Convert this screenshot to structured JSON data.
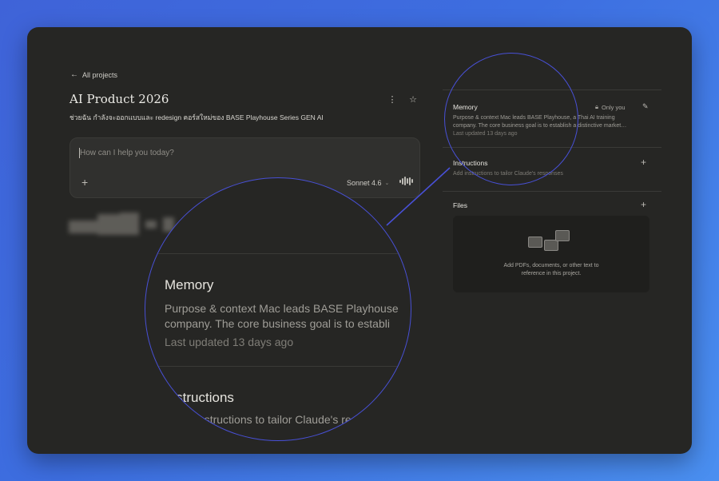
{
  "nav": {
    "back_label": "All projects"
  },
  "project": {
    "title": "AI Product 2026",
    "description": "ช่วยฉัน กำลังจะออกแบบและ redesign คอร์สใหม่ของ BASE Playhouse Series GEN AI"
  },
  "composer": {
    "placeholder": "How can I help you today?",
    "model": "Sonnet 4.6"
  },
  "memory": {
    "title": "Memory",
    "visibility": "Only you",
    "text_line1": "Purpose & context Mac leads BASE Playhouse, a Thai AI training",
    "text_line2": "company. The core business goal is to establish a distinctive market…",
    "updated": "Last updated 13 days ago"
  },
  "instructions": {
    "title": "Instructions",
    "hint": "Add instructions to tailor Claude's responses"
  },
  "files": {
    "title": "Files",
    "hint_line1": "Add PDFs, documents, or other text to",
    "hint_line2": "reference in this project."
  },
  "lens": {
    "memory_title": "Memory",
    "memory_line1": "Purpose & context Mac leads BASE Playhouse",
    "memory_line2": "company. The core business goal is to establi",
    "updated": "Last updated 13 days ago",
    "instructions_title": "Instructions",
    "instructions_hint": "Add instructions to tailor Claude's re"
  },
  "colors": {
    "lens_ring": "#4850d6",
    "background": "#3d6ee0",
    "panel": "#262624"
  }
}
